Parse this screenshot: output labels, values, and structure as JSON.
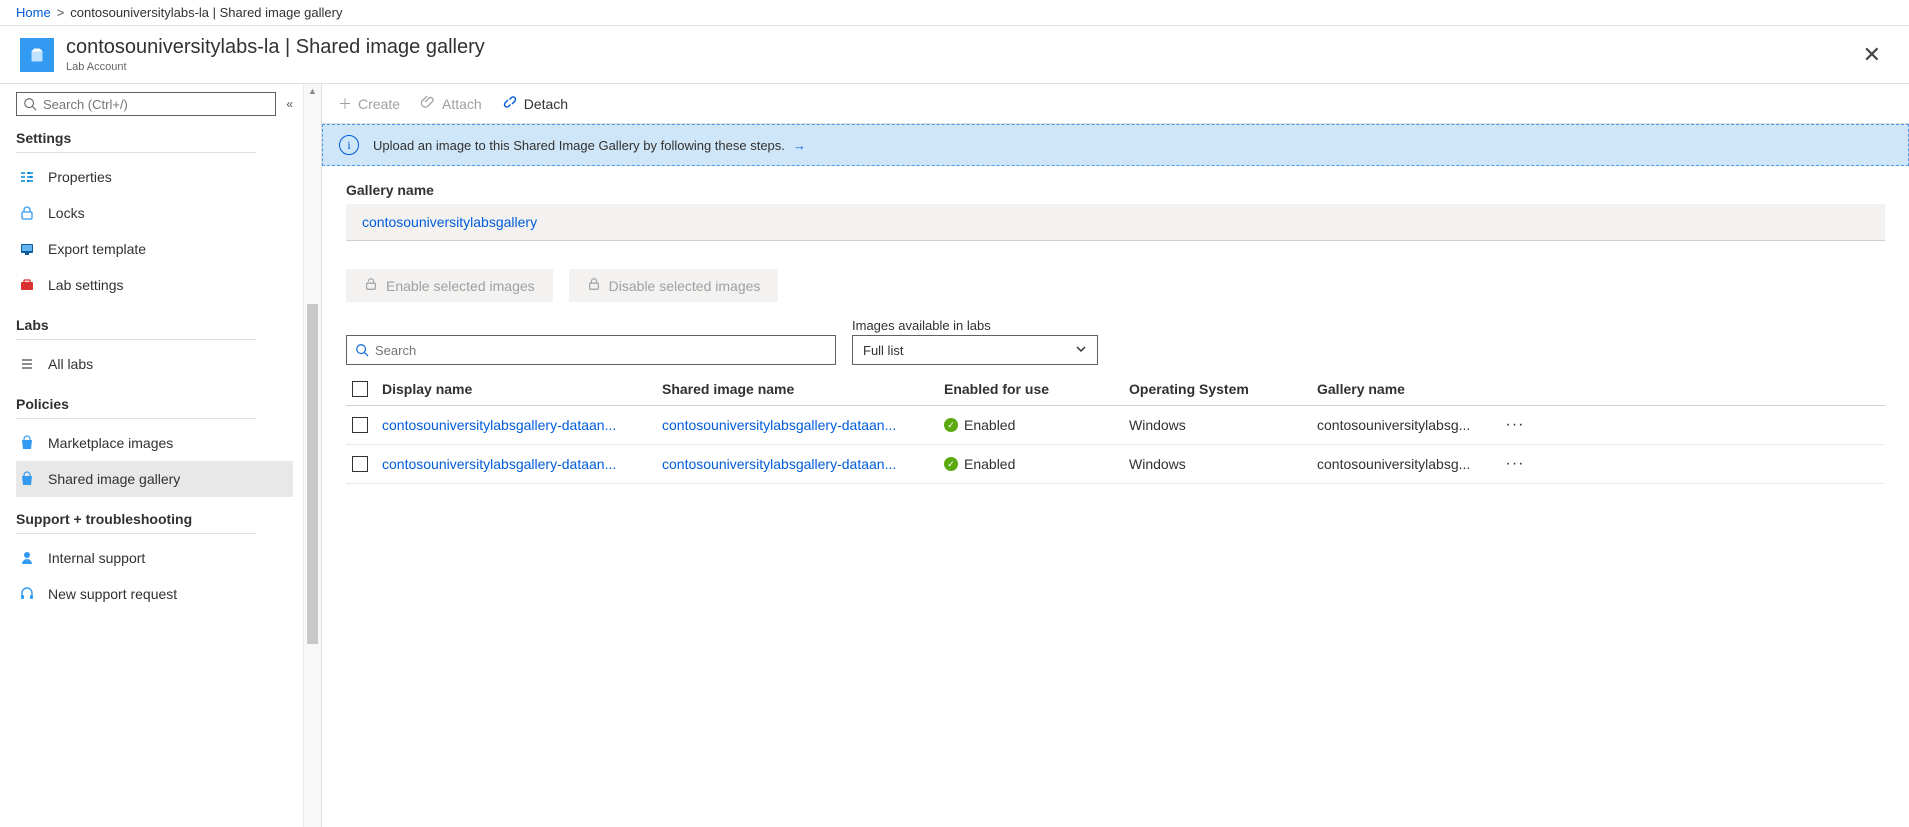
{
  "breadcrumb": {
    "home": "Home",
    "current": "contosouniversitylabs-la | Shared image gallery"
  },
  "header": {
    "title": "contosouniversitylabs-la | Shared image gallery",
    "subtitle": "Lab Account"
  },
  "sidebar": {
    "search_placeholder": "Search (Ctrl+/)",
    "sections": {
      "settings": "Settings",
      "labs": "Labs",
      "policies": "Policies",
      "support": "Support + troubleshooting"
    },
    "items": {
      "properties": "Properties",
      "locks": "Locks",
      "export_template": "Export template",
      "lab_settings": "Lab settings",
      "all_labs": "All labs",
      "marketplace_images": "Marketplace images",
      "shared_image_gallery": "Shared image gallery",
      "internal_support": "Internal support",
      "new_support_request": "New support request"
    }
  },
  "toolbar": {
    "create": "Create",
    "attach": "Attach",
    "detach": "Detach"
  },
  "banner": {
    "text": "Upload an image to this Shared Image Gallery by following these steps."
  },
  "content": {
    "gallery_label": "Gallery name",
    "gallery_link": "contosouniversitylabsgallery",
    "enable_btn": "Enable selected images",
    "disable_btn": "Disable selected images",
    "search_placeholder": "Search",
    "filter_label": "Images available in labs",
    "filter_value": "Full list"
  },
  "table": {
    "headers": {
      "display": "Display name",
      "shared": "Shared image name",
      "enabled": "Enabled for use",
      "os": "Operating System",
      "gallery": "Gallery name"
    },
    "rows": [
      {
        "display": "contosouniversitylabsgallery-dataan...",
        "shared": "contosouniversitylabsgallery-dataan...",
        "enabled": "Enabled",
        "os": "Windows",
        "gallery": "contosouniversitylabsg..."
      },
      {
        "display": "contosouniversitylabsgallery-dataan...",
        "shared": "contosouniversitylabsgallery-dataan...",
        "enabled": "Enabled",
        "os": "Windows",
        "gallery": "contosouniversitylabsg..."
      }
    ]
  }
}
